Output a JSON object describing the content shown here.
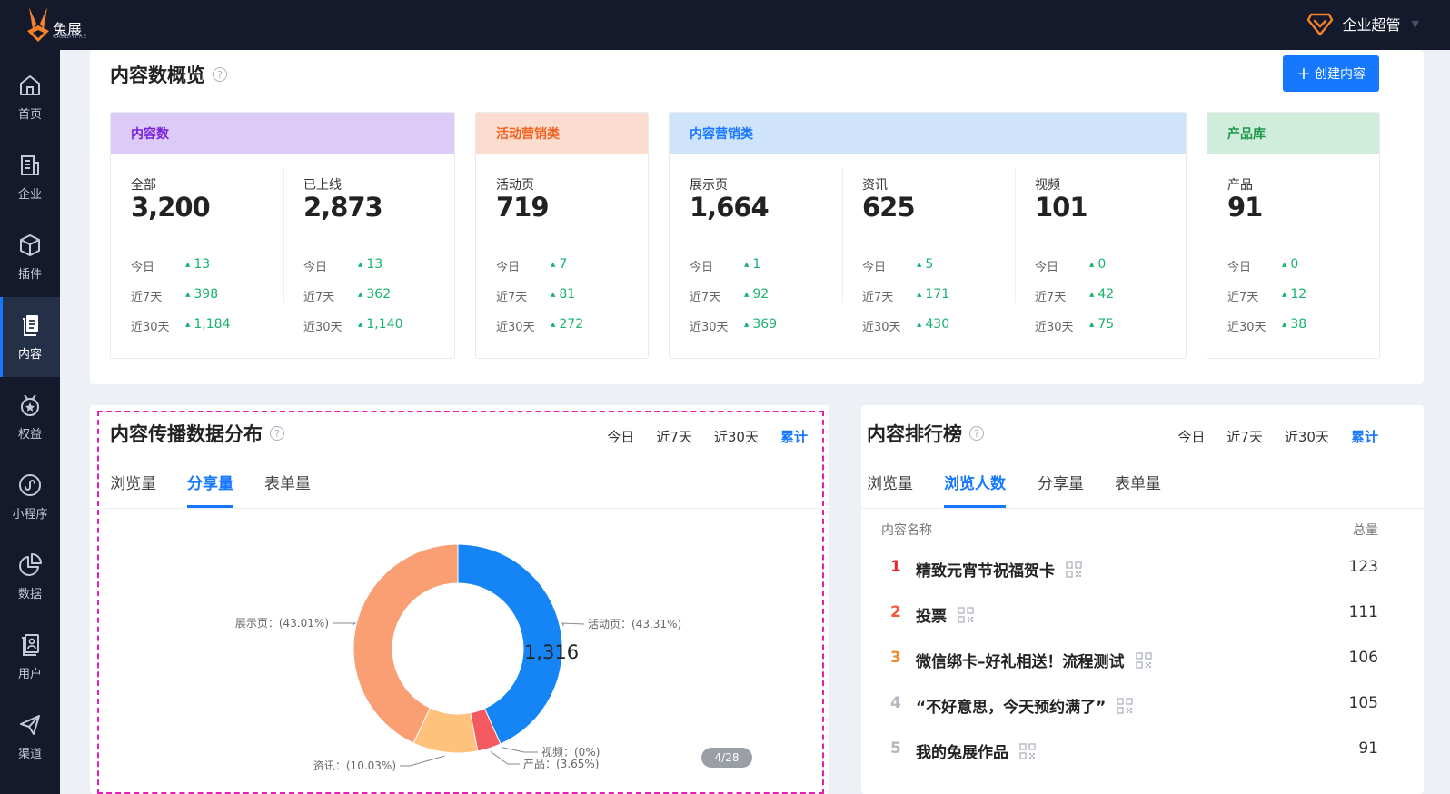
{
  "app": {
    "logo_text": "兔展",
    "logo_sub": "RABBITPRE",
    "user_name": "企业超管"
  },
  "sidebar": {
    "items": [
      {
        "label": "首页",
        "icon": "home-icon"
      },
      {
        "label": "企业",
        "icon": "building-icon"
      },
      {
        "label": "插件",
        "icon": "cube-icon"
      },
      {
        "label": "内容",
        "icon": "document-icon",
        "active": true
      },
      {
        "label": "权益",
        "icon": "badge-icon"
      },
      {
        "label": "小程序",
        "icon": "miniprogram-icon"
      },
      {
        "label": "数据",
        "icon": "pie-chart-icon"
      },
      {
        "label": "用户",
        "icon": "user-list-icon"
      },
      {
        "label": "渠道",
        "icon": "paper-plane-icon"
      }
    ]
  },
  "overview": {
    "title": "内容数概览",
    "help": "?",
    "create_button": "创建内容",
    "row_labels": {
      "today": "今日",
      "d7": "近7天",
      "d30": "近30天"
    },
    "cards": [
      {
        "title": "内容数",
        "title_color": "#7a22e0",
        "head_bg": "#dccbf7",
        "cols": [
          {
            "label": "全部",
            "value": "3,200",
            "today": "13",
            "d7": "398",
            "d30": "1,184"
          },
          {
            "label": "已上线",
            "value": "2,873",
            "today": "13",
            "d7": "362",
            "d30": "1,140"
          }
        ]
      },
      {
        "title": "活动营销类",
        "title_color": "#f2621f",
        "head_bg": "#fcdccf",
        "cols": [
          {
            "label": "活动页",
            "value": "719",
            "today": "7",
            "d7": "81",
            "d30": "272"
          }
        ]
      },
      {
        "title": "内容营销类",
        "title_color": "#1677ff",
        "head_bg": "#cfe3fb",
        "cols": [
          {
            "label": "展示页",
            "value": "1,664",
            "today": "1",
            "d7": "92",
            "d30": "369"
          },
          {
            "label": "资讯",
            "value": "625",
            "today": "5",
            "d7": "171",
            "d30": "430"
          },
          {
            "label": "视频",
            "value": "101",
            "today": "0",
            "d7": "42",
            "d30": "75"
          }
        ]
      },
      {
        "title": "产品库",
        "title_color": "#1e9a4d",
        "head_bg": "#d0ecda",
        "cols": [
          {
            "label": "产品",
            "value": "91",
            "today": "0",
            "d7": "12",
            "d30": "38"
          }
        ]
      }
    ]
  },
  "distribution": {
    "title": "内容传播数据分布",
    "range_tabs": [
      "今日",
      "近7天",
      "近30天",
      "累计"
    ],
    "active_range": "累计",
    "metric_tabs": [
      "浏览量",
      "分享量",
      "表单量"
    ],
    "active_metric": "分享量",
    "total": "1,316",
    "pager": "4/28",
    "chart_data": {
      "type": "pie",
      "donut": true,
      "center_value": 1316,
      "slices": [
        {
          "name": "活动页",
          "label": "活动页：(43.31%)",
          "value": 43.31,
          "color": "#1585f5"
        },
        {
          "name": "视频",
          "label": "视频：(0%)",
          "value": 0,
          "color": "#8a8a8a"
        },
        {
          "name": "产品",
          "label": "产品：(3.65%)",
          "value": 3.65,
          "color": "#f45a5f"
        },
        {
          "name": "资讯",
          "label": "资讯：(10.03%)",
          "value": 10.03,
          "color": "#fec27c"
        },
        {
          "name": "展示页",
          "label": "展示页：(43.01%)",
          "value": 43.01,
          "color": "#fa9e74"
        }
      ]
    }
  },
  "ranking": {
    "title": "内容排行榜",
    "range_tabs": [
      "今日",
      "近7天",
      "近30天",
      "累计"
    ],
    "active_range": "累计",
    "metric_tabs": [
      "浏览量",
      "浏览人数",
      "分享量",
      "表单量"
    ],
    "active_metric": "浏览人数",
    "col_name": "内容名称",
    "col_total": "总量",
    "rows": [
      {
        "rank": "1",
        "name": "精致元宵节祝福贺卡",
        "total": "123",
        "color": "#f0262f"
      },
      {
        "rank": "2",
        "name": "投票",
        "total": "111",
        "color": "#f25a3b"
      },
      {
        "rank": "3",
        "name": "微信绑卡–好礼相送！流程测试",
        "total": "106",
        "color": "#f28a25"
      },
      {
        "rank": "4",
        "name": "“不好意思，今天预约满了”",
        "total": "105",
        "color": "#b4b8c0"
      },
      {
        "rank": "5",
        "name": "我的兔展作品",
        "total": "91",
        "color": "#b4b8c0"
      }
    ]
  }
}
